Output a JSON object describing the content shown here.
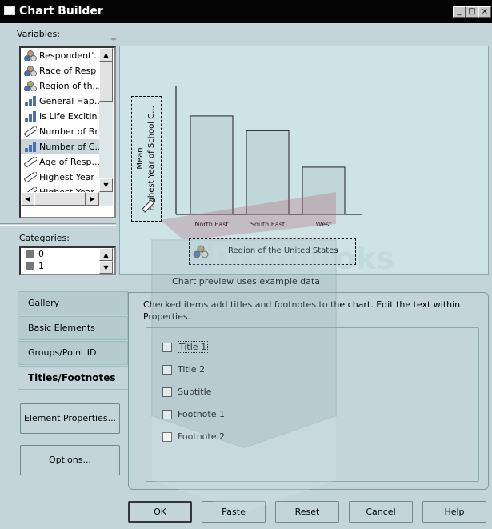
{
  "window": {
    "title": "Chart Builder",
    "controls": [
      "_",
      "□",
      "×"
    ]
  },
  "variables": {
    "label_prefix": "",
    "label_u": "V",
    "label_rest": "ariables:",
    "items": [
      {
        "label": "Respondent'...",
        "icon": "nominal-icon"
      },
      {
        "label": "Race of Resp",
        "icon": "nominal-icon"
      },
      {
        "label": "Region of th...",
        "icon": "nominal-icon"
      },
      {
        "label": "General Hap...",
        "icon": "ordinal-icon"
      },
      {
        "label": "Is Life Excitin",
        "icon": "ordinal-icon"
      },
      {
        "label": "Number of Br",
        "icon": "scale-icon"
      },
      {
        "label": "Number of C...",
        "icon": "ordinal-icon"
      },
      {
        "label": "Age of Resp...",
        "icon": "scale-icon"
      },
      {
        "label": "Highest Year",
        "icon": "scale-icon"
      },
      {
        "label": "Highest Year",
        "icon": "scale-icon"
      }
    ]
  },
  "categories": {
    "label": "Categories:",
    "items": [
      "0",
      "1"
    ]
  },
  "preview": {
    "y_label_line1": "Mean",
    "y_label_line2": "Highest Year of School C...",
    "x_label": "Region of the United States",
    "note": "Chart preview uses example data"
  },
  "chart_data": {
    "type": "bar",
    "categories": [
      "North East",
      "South East",
      "West"
    ],
    "values": [
      100,
      85,
      48
    ],
    "ylim": [
      0,
      130
    ],
    "xlabel": "Region of the United States",
    "ylabel": "Mean Highest Year of School C..."
  },
  "tabs": [
    {
      "label": "Gallery"
    },
    {
      "label": "Basic Elements"
    },
    {
      "label": "Groups/Point ID"
    },
    {
      "label": "Titles/Footnotes"
    }
  ],
  "side_buttons": {
    "element_properties": "Element Properties...",
    "options": "Options..."
  },
  "panel": {
    "description": "Checked items add titles and footnotes to the chart. Edit the text within Properties.",
    "checks": [
      {
        "label": "Title 1",
        "checked": false
      },
      {
        "label": "Title 2",
        "checked": false
      },
      {
        "label": "Subtitle",
        "checked": false
      },
      {
        "label": "Footnote 1",
        "checked": false
      },
      {
        "label": "Footnote 2",
        "checked": false
      }
    ]
  },
  "buttons": {
    "ok": "OK",
    "paste": "Paste",
    "reset": "Reset",
    "cancel": "Cancel",
    "help": "Help"
  },
  "watermark_text": "Dropbooks"
}
